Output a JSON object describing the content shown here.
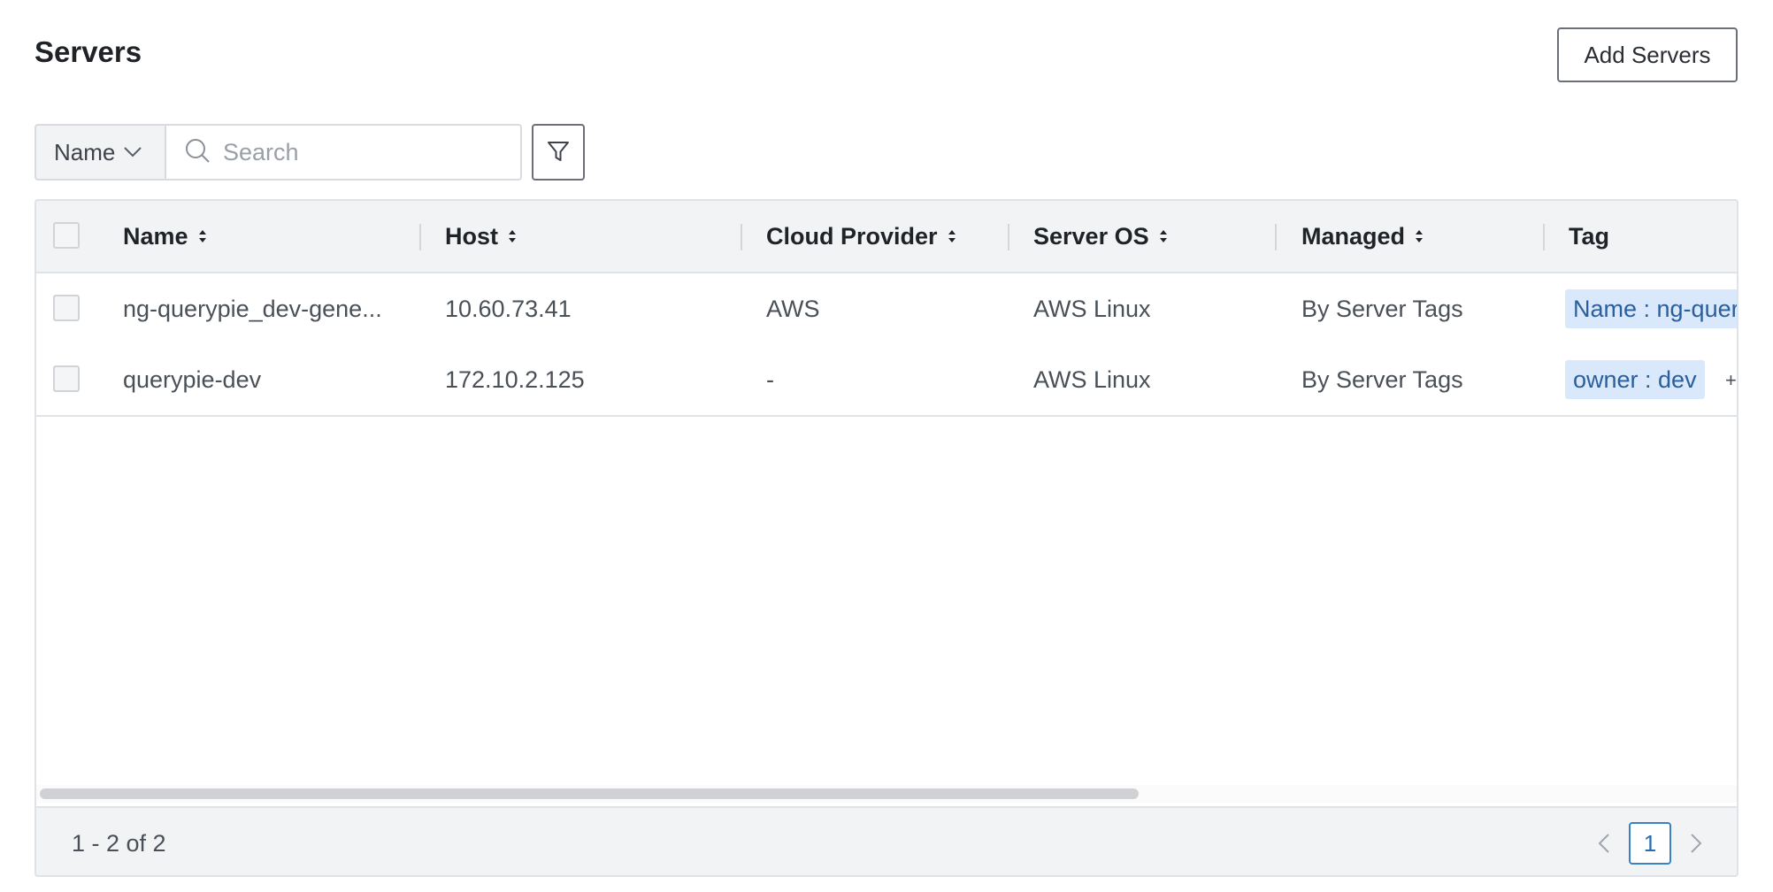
{
  "header": {
    "title": "Servers",
    "add_button": "Add Servers"
  },
  "toolbar": {
    "field_select": "Name",
    "search_placeholder": "Search",
    "search_value": ""
  },
  "table": {
    "columns": [
      "Name",
      "Host",
      "Cloud Provider",
      "Server OS",
      "Managed",
      "Tag"
    ],
    "rows": [
      {
        "name": "ng-querypie_dev-gene...",
        "host": "10.60.73.41",
        "cloud_provider": "AWS",
        "server_os": "AWS Linux",
        "managed": "By Server Tags",
        "tag": "Name : ng-quer",
        "more": ""
      },
      {
        "name": "querypie-dev",
        "host": "172.10.2.125",
        "cloud_provider": "-",
        "server_os": "AWS Linux",
        "managed": "By Server Tags",
        "tag": "owner : dev",
        "more": "+"
      }
    ]
  },
  "footer": {
    "range": "1 - 2 of 2",
    "current_page": "1"
  },
  "colors": {
    "accent": "#3b82c4",
    "tag_bg": "#d9e8fb",
    "tag_text": "#2b5f9c",
    "header_bg": "#f2f3f5"
  },
  "icons": [
    "chevron-down-icon",
    "search-icon",
    "filter-icon",
    "sort-icon",
    "chevron-left-icon",
    "chevron-right-icon"
  ]
}
